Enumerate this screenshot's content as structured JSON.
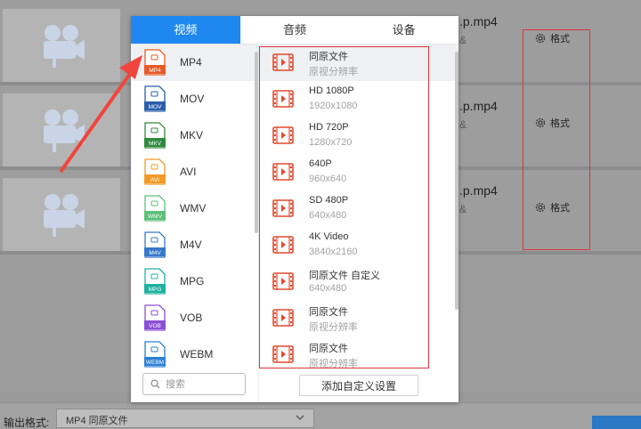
{
  "tabs": [
    {
      "label": "视频",
      "active": true
    },
    {
      "label": "音频",
      "active": false
    },
    {
      "label": "设备",
      "active": false
    }
  ],
  "formats": [
    {
      "label": "MP4",
      "badge": "MP4",
      "color": "#e85a28",
      "selected": true
    },
    {
      "label": "MOV",
      "badge": "MOV",
      "color": "#2a5fab",
      "selected": false
    },
    {
      "label": "MKV",
      "badge": "MKV",
      "color": "#2f8a3e",
      "selected": false
    },
    {
      "label": "AVI",
      "badge": "AVI",
      "color": "#f29a27",
      "selected": false
    },
    {
      "label": "WMV",
      "badge": "WMV",
      "color": "#5bbf78",
      "selected": false
    },
    {
      "label": "M4V",
      "badge": "M4V",
      "color": "#3778c9",
      "selected": false
    },
    {
      "label": "MPG",
      "badge": "MPG",
      "color": "#1fb1a0",
      "selected": false
    },
    {
      "label": "VOB",
      "badge": "VOB",
      "color": "#8b4fd6",
      "selected": false
    },
    {
      "label": "WEBM",
      "badge": "WEBM",
      "color": "#2b7fd6",
      "selected": false
    }
  ],
  "presets": [
    {
      "name": "同原文件",
      "res": "原视分辨率",
      "selected": true
    },
    {
      "name": "HD 1080P",
      "res": "1920x1080",
      "selected": false
    },
    {
      "name": "HD 720P",
      "res": "1280x720",
      "selected": false
    },
    {
      "name": "640P",
      "res": "960x640",
      "selected": false
    },
    {
      "name": "SD 480P",
      "res": "640x480",
      "selected": false
    },
    {
      "name": "4K Video",
      "res": "3840x2160",
      "selected": false
    },
    {
      "name": "同原文件 自定义",
      "res": "640x480",
      "selected": false
    },
    {
      "name": "同原文件",
      "res": "原视分辨率",
      "selected": false
    },
    {
      "name": "同原文件",
      "res": "原视分辨率",
      "selected": false
    }
  ],
  "search": {
    "placeholder": "搜索"
  },
  "add_custom_label": "添加自定义设置",
  "files": [
    {
      "name": ".p.mp4",
      "sub": "&",
      "format_label": "格式"
    },
    {
      "name": ".p.mp4",
      "sub": "&",
      "format_label": "格式"
    },
    {
      "name": ".p.mp4",
      "sub": "&",
      "format_label": "格式"
    }
  ],
  "output": {
    "label": "输出格式:",
    "value": "MP4  同原文件"
  },
  "colors": {
    "accent": "#1e88f0",
    "annotation": "#e0323a",
    "preset_icon": "#e2492f"
  }
}
